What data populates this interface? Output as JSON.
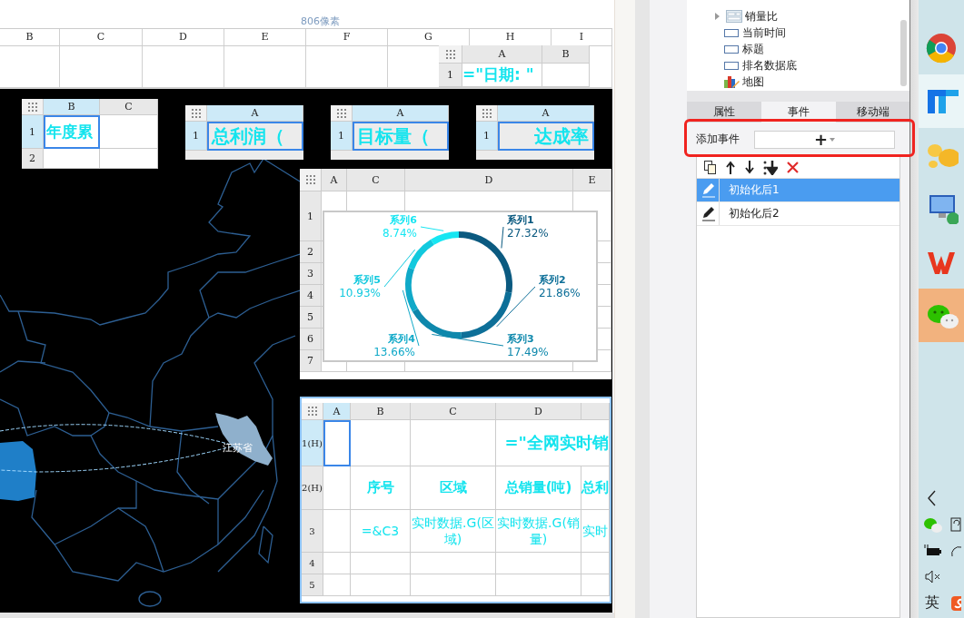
{
  "designer": {
    "ruler_label": "806像素",
    "sheet_columns": [
      "B",
      "C",
      "D",
      "E",
      "F",
      "G",
      "H",
      "I"
    ],
    "date_widget": {
      "columns": [
        {
          "label": "A",
          "selected": false
        },
        {
          "label": "B",
          "selected": false
        }
      ],
      "rows": [
        {
          "label": "1",
          "selected": false,
          "cells": [
            {
              "text": "=\"日期: \"",
              "kind": "title",
              "selected": false
            },
            {
              "selected": false
            }
          ]
        }
      ]
    },
    "kpi_widgets": [
      {
        "columns": [
          {
            "label": "B",
            "selected": true
          },
          {
            "label": "C",
            "selected": false
          }
        ],
        "rows": [
          {
            "label": "1",
            "selected": true,
            "cells": [
              {
                "text": "年度累",
                "kind": "title",
                "selected": true
              },
              {
                "selected": false
              }
            ]
          },
          {
            "label": "2",
            "selected": false,
            "cells": [
              {
                "selected": false
              },
              {
                "selected": false
              }
            ]
          }
        ]
      },
      {
        "columns": [
          {
            "label": "A",
            "selected": true
          }
        ],
        "rows": [
          {
            "label": "1",
            "selected": true,
            "cells": [
              {
                "text": "总利润（",
                "kind": "title",
                "selected": true
              }
            ]
          }
        ]
      },
      {
        "columns": [
          {
            "label": "A",
            "selected": true
          }
        ],
        "rows": [
          {
            "label": "1",
            "selected": true,
            "cells": [
              {
                "text": "目标量（",
                "kind": "title",
                "selected": true
              }
            ]
          }
        ]
      },
      {
        "columns": [
          {
            "label": "A",
            "selected": true
          }
        ],
        "rows": [
          {
            "label": "1",
            "selected": true,
            "cells": [
              {
                "text": "达成率",
                "kind": "title",
                "selected": true
              }
            ]
          }
        ]
      }
    ],
    "map": {
      "region_label": "江苏省"
    },
    "chart_widget": {
      "columns": [
        {
          "label": "A",
          "selected": false
        },
        {
          "label": "C",
          "selected": false
        },
        {
          "label": "D",
          "selected": false
        },
        {
          "label": "E",
          "selected": false
        }
      ],
      "rows": [
        {
          "label": "1",
          "selected": false
        },
        {
          "label": "2",
          "selected": false
        },
        {
          "label": "3",
          "selected": false
        },
        {
          "label": "4",
          "selected": false
        },
        {
          "label": "5",
          "selected": false
        },
        {
          "label": "6",
          "selected": false
        },
        {
          "label": "7",
          "selected": false
        }
      ],
      "chart_data": {
        "type": "donut",
        "data_labels": true,
        "categories": [
          "系列1",
          "系列2",
          "系列3",
          "系列4",
          "系列5",
          "系列6"
        ],
        "values": [
          27.32,
          21.86,
          17.49,
          13.66,
          10.93,
          8.74
        ],
        "value_labels": [
          "27.32%",
          "21.86%",
          "17.49%",
          "13.66%",
          "10.93%",
          "8.74%"
        ],
        "colors": [
          "#0b5a80",
          "#0d6f98",
          "#0e88ac",
          "#10a9c8",
          "#12c9de",
          "#16e6f2"
        ]
      }
    },
    "table_widget": {
      "columns": [
        {
          "label": "A",
          "selected": true
        },
        {
          "label": "B",
          "selected": false
        },
        {
          "label": "C",
          "selected": false
        },
        {
          "label": "D",
          "selected": false
        }
      ],
      "rows": [
        {
          "label": "1(H)",
          "selected": true,
          "cells": [
            {
              "selected": true
            },
            {
              "selected": false
            },
            {
              "selected": false
            },
            {
              "text": "=\"全网实时销",
              "kind": "title",
              "selected": false
            }
          ]
        },
        {
          "label": "2(H)",
          "selected": false,
          "cells": [
            {
              "selected": false
            },
            {
              "text": "序号",
              "kind": "header",
              "selected": false
            },
            {
              "text": "区域",
              "kind": "header",
              "selected": false
            },
            {
              "text": "总销量(吨)",
              "kind": "header",
              "selected": false
            },
            {
              "text": "总利",
              "kind": "header",
              "selected": false
            }
          ]
        },
        {
          "label": "3",
          "selected": false,
          "cells": [
            {
              "selected": false
            },
            {
              "text": "=&C3",
              "kind": "value",
              "selected": false
            },
            {
              "text": "实时数据.G(区域)",
              "kind": "value",
              "selected": false
            },
            {
              "text": "实时数据.G(销量)",
              "kind": "value",
              "selected": false
            },
            {
              "text": "实时",
              "kind": "value",
              "selected": false
            }
          ]
        },
        {
          "label": "4",
          "selected": false,
          "cells": [
            {
              "selected": false
            },
            {
              "selected": false
            },
            {
              "selected": false
            },
            {
              "selected": false
            },
            {
              "selected": false
            }
          ]
        },
        {
          "label": "5",
          "selected": false,
          "cells": [
            {
              "selected": false
            },
            {
              "selected": false
            },
            {
              "selected": false
            },
            {
              "selected": false
            },
            {
              "selected": false
            }
          ]
        }
      ]
    }
  },
  "side_panel": {
    "tree": [
      {
        "label": "销量比",
        "kind": "report",
        "expanded": false
      },
      {
        "label": "当前时间",
        "kind": "widget"
      },
      {
        "label": "标题",
        "kind": "widget"
      },
      {
        "label": "排名数据底",
        "kind": "widget"
      },
      {
        "label": "地图",
        "kind": "chart"
      }
    ],
    "tabs": [
      {
        "label": "属性",
        "selected": false
      },
      {
        "label": "事件",
        "selected": true
      },
      {
        "label": "移动端",
        "selected": false
      }
    ],
    "add_event": {
      "label": "添加事件",
      "button": "+"
    },
    "events": [
      {
        "label": "初始化后1",
        "selected": true
      },
      {
        "label": "初始化后2",
        "selected": false
      }
    ]
  },
  "taskbar": {
    "apps": [
      {
        "kind": "browser",
        "active": false
      },
      {
        "kind": "blue-app",
        "active": false
      },
      {
        "kind": "yellow-app",
        "active": false
      },
      {
        "kind": "remote-desktop",
        "active": false
      },
      {
        "kind": "office",
        "active": false
      },
      {
        "kind": "messenger",
        "active": true
      }
    ],
    "input_method": "英"
  }
}
